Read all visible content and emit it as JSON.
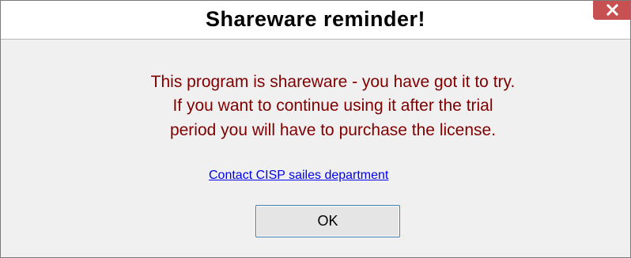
{
  "window": {
    "title": "Shareware reminder!",
    "close_icon": "close-icon"
  },
  "message": {
    "line1": "This program is shareware - you have got it to try.",
    "line2": "If you want to continue using it after the trial",
    "line3": "period you will have to purchase the license."
  },
  "contact_link": {
    "label": "Contact CISP sailes department"
  },
  "ok_button": {
    "label": "OK"
  },
  "colors": {
    "message_text": "#800000",
    "link": "#0000ee",
    "close_button": "#c75050",
    "button_border": "#3c7fb1"
  }
}
